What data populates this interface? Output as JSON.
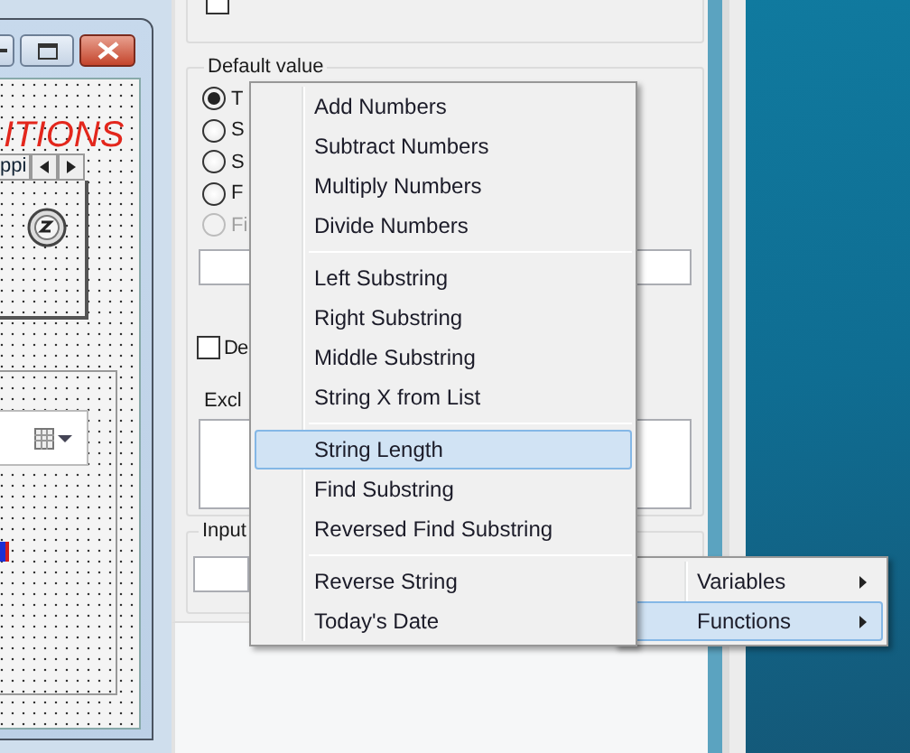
{
  "designer_window": {
    "heading": "ITIONS",
    "tab_label": "ppi"
  },
  "dialog": {
    "top_checkbox": {
      "checked": false
    },
    "default_value": {
      "title": "Default value",
      "options": [
        {
          "label": "T",
          "selected": true,
          "disabled": false
        },
        {
          "label": "S",
          "selected": false,
          "disabled": false
        },
        {
          "label": "S",
          "selected": false,
          "disabled": false
        },
        {
          "label": "F",
          "selected": false,
          "disabled": false
        },
        {
          "label": "Fi",
          "selected": false,
          "disabled": true
        }
      ]
    },
    "checkbox": {
      "label": "De",
      "checked": false
    },
    "list_label": "Excl",
    "input_group": {
      "title": "Input"
    }
  },
  "submenu": {
    "items": [
      {
        "kind": "item",
        "label": "Add Numbers",
        "selected": false
      },
      {
        "kind": "item",
        "label": "Subtract Numbers",
        "selected": false
      },
      {
        "kind": "item",
        "label": "Multiply Numbers",
        "selected": false
      },
      {
        "kind": "item",
        "label": "Divide Numbers",
        "selected": false
      },
      {
        "kind": "separator"
      },
      {
        "kind": "item",
        "label": "Left Substring",
        "selected": false
      },
      {
        "kind": "item",
        "label": "Right Substring",
        "selected": false
      },
      {
        "kind": "item",
        "label": "Middle Substring",
        "selected": false
      },
      {
        "kind": "item",
        "label": "String X from List",
        "selected": false
      },
      {
        "kind": "separator"
      },
      {
        "kind": "item",
        "label": "String Length",
        "selected": true
      },
      {
        "kind": "item",
        "label": "Find Substring",
        "selected": false
      },
      {
        "kind": "item",
        "label": "Reversed Find Substring",
        "selected": false
      },
      {
        "kind": "separator"
      },
      {
        "kind": "item",
        "label": "Reverse String",
        "selected": false
      },
      {
        "kind": "item",
        "label": "Today's Date",
        "selected": false
      }
    ]
  },
  "menu": {
    "items": [
      {
        "label": "Variables",
        "selected": false
      },
      {
        "label": "Functions",
        "selected": true
      }
    ]
  }
}
